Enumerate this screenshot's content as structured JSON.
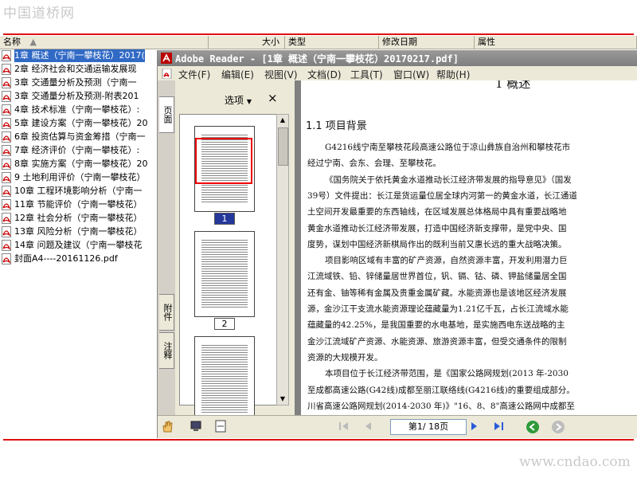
{
  "watermark_top": "中国道桥网",
  "watermark_bottom": "www.cndao.com",
  "columns": {
    "name": "名称",
    "size": "大小",
    "type": "类型",
    "modified": "修改日期",
    "attributes": "属性"
  },
  "files": [
    {
      "label": "1章  概述（宁南一攀枝花）2017(",
      "selected": true
    },
    {
      "label": "2章  经济社会和交通运输发展现"
    },
    {
      "label": "3章  交通量分析及预测（宁南一"
    },
    {
      "label": "3章  交通量分析及预测-附表201"
    },
    {
      "label": "4章  技术标准（宁南一攀枝花）:"
    },
    {
      "label": "5章 建设方案（宁南一攀枝花）20"
    },
    {
      "label": "6章 投资估算与资金筹措（宁南一"
    },
    {
      "label": "7章  经济评价（宁南一攀枝花）:"
    },
    {
      "label": "8章 实施方案（宁南一攀枝花）20"
    },
    {
      "label": "9 土地利用评价（宁南一攀枝花）"
    },
    {
      "label": "10章 工程环境影响分析（宁南一"
    },
    {
      "label": "11章   节能评价（宁南一攀枝花）"
    },
    {
      "label": "12章  社会分析（宁南一攀枝花）"
    },
    {
      "label": "13章  风险分析（宁南一攀枝花）"
    },
    {
      "label": "14章  问题及建议（宁南一攀枝花"
    },
    {
      "label": "封面A4----20161126.pdf"
    }
  ],
  "reader": {
    "title": "Adobe Reader - [1章  概述（宁南一攀枝花）20170217.pdf]",
    "menu": [
      "文件(F)",
      "编辑(E)",
      "视图(V)",
      "文档(D)",
      "工具(T)",
      "窗口(W)",
      "帮助(H)"
    ],
    "tabs": {
      "pages": "页面",
      "attachments": "附件",
      "comments": "注释"
    },
    "options_label": "选项",
    "thumb_labels": [
      "1",
      "2"
    ],
    "page_box": "第1/ 18页",
    "doc": {
      "heading_partial": "1  概述",
      "section": "1.1   项目背景",
      "lines": [
        "G4216线宁南至攀枝花段高速公路位于凉山彝族自治州和攀枝花市",
        "经过宁南、会东、会理、至攀枝花。",
        "《国务院关于依托黄金水道推动长江经济带发展的指导意见》（国发",
        "39号）文件提出：长江是货运量位居全球内河第一的黄金水道，长江通道",
        "土空间开发最重要的东西轴线，在区域发展总体格局中具有重要战略地",
        "黄金水道推动长江经济带发展，打造中国经济新支撑带，是党中央、国",
        "度势，谋划中国经济新棋局作出的既利当前又惠长远的重大战略决策。",
        "项目影响区域有丰富的矿产资源，自然资源丰富，开发利用潜力巨",
        "江流域铁、铅、锌储量居世界首位，钒、镉、钴、磷、钾盐储量居全国",
        "还有金、铀等稀有金属及贵重金属矿藏。水能资源也是该地区经济发展",
        "源，金沙江干支流水能资源理论蕴藏量为1.21亿千瓦，占长江流域水能",
        "蕴藏量的42.25%，是我国重要的水电基地，是实施西电东送战略的主",
        "金沙江流域矿产资源、水能资源、旅游资源丰富，但受交通条件的限制",
        "资源的大规模开发。",
        "本项目位于长江经济带范围，是《国家公路网规划(2013 年-2030",
        "至成都高速公路(G42线)成都至丽江联络线(G4216线)的重要组成部分。",
        "川省高速公路网规划(2014-2030 年)》\"16、8、8\"高速公路网中成都至"
      ]
    }
  }
}
